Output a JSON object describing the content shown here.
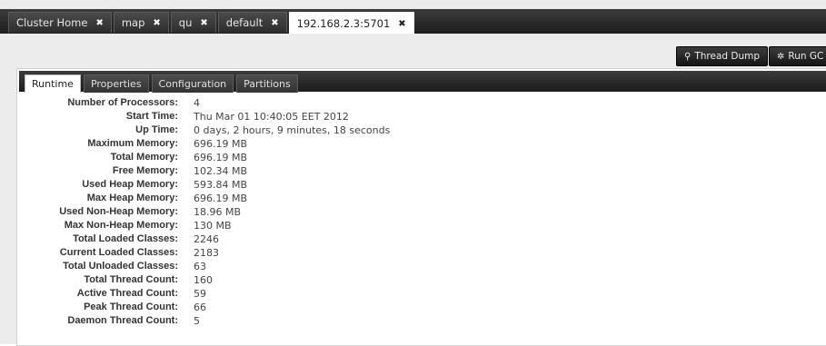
{
  "top_tabs": [
    {
      "label": "Cluster Home",
      "close": "✖"
    },
    {
      "label": "map",
      "close": "✖"
    },
    {
      "label": "qu",
      "close": "✖"
    },
    {
      "label": "default",
      "close": "✖"
    },
    {
      "label": "192.168.2.3:5701",
      "close": "✖"
    }
  ],
  "toolbar": {
    "thread_dump": {
      "icon": "search-icon",
      "glyph": "⚲",
      "label": "Thread Dump"
    },
    "run_gc": {
      "icon": "gear-icon",
      "glyph": "✲",
      "label": "Run GC"
    }
  },
  "panel_tabs": [
    {
      "label": "Runtime"
    },
    {
      "label": "Properties"
    },
    {
      "label": "Configuration"
    },
    {
      "label": "Partitions"
    }
  ],
  "runtime": [
    {
      "label": "Number of Processors:",
      "value": "4"
    },
    {
      "label": "Start Time:",
      "value": "Thu Mar 01 10:40:05 EET 2012"
    },
    {
      "label": "Up Time:",
      "value": "0 days, 2 hours, 9 minutes, 18 seconds"
    },
    {
      "label": "Maximum Memory:",
      "value": "696.19 MB"
    },
    {
      "label": "Total Memory:",
      "value": "696.19 MB"
    },
    {
      "label": "Free Memory:",
      "value": "102.34 MB"
    },
    {
      "label": "Used Heap Memory:",
      "value": "593.84 MB"
    },
    {
      "label": "Max Heap Memory:",
      "value": "696.19 MB"
    },
    {
      "label": "Used Non-Heap Memory:",
      "value": "18.96 MB"
    },
    {
      "label": "Max Non-Heap Memory:",
      "value": "130 MB"
    },
    {
      "label": "Total Loaded Classes:",
      "value": "2246"
    },
    {
      "label": "Current Loaded Classes:",
      "value": "2183"
    },
    {
      "label": "Total Unloaded Classes:",
      "value": "63"
    },
    {
      "label": "Total Thread Count:",
      "value": "160"
    },
    {
      "label": "Active Thread Count:",
      "value": "59"
    },
    {
      "label": "Peak Thread Count:",
      "value": "66"
    },
    {
      "label": "Daemon Thread Count:",
      "value": "5"
    }
  ]
}
